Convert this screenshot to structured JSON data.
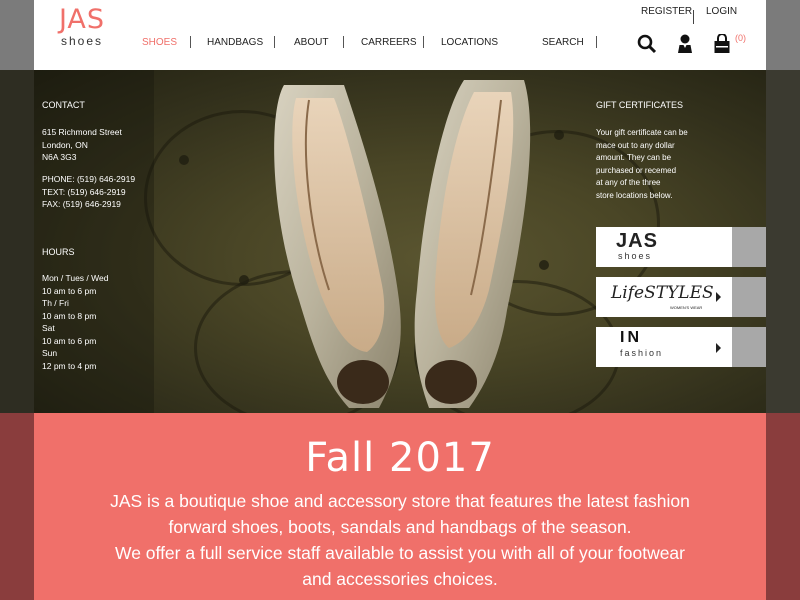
{
  "header": {
    "logo_top": "JAS",
    "logo_bottom": "shoes",
    "register": "REGISTER",
    "login": "LOGIN",
    "cart_count": "(0)"
  },
  "nav": {
    "items": [
      {
        "label": "SHOES",
        "active": true
      },
      {
        "label": "HANDBAGS",
        "active": false
      },
      {
        "label": "ABOUT",
        "active": false
      },
      {
        "label": "CARREERS",
        "active": false
      },
      {
        "label": "LOCATIONS",
        "active": false
      },
      {
        "label": "SEARCH",
        "active": false
      }
    ]
  },
  "contact": {
    "heading": "CONTACT",
    "address1": "615 Richmond Street",
    "address2": "London, ON",
    "address3": "N6A 3G3",
    "phone": "PHONE: (519) 646-2919",
    "text": "TEXT: (519) 646-2919",
    "fax": "FAX: (519) 646-2919"
  },
  "hours": {
    "heading": "HOURS",
    "lines": [
      "Mon / Tues / Wed",
      "10 am to 6 pm",
      "Th / Fri",
      "10 am to 8 pm",
      "Sat",
      "10 am to 6 pm",
      "Sun",
      "12 pm to 4 pm"
    ]
  },
  "gift": {
    "heading": "GIFT CERTIFICATES",
    "lines": [
      "Your gift certificate can be",
      "mace out to any dollar",
      "amount. They can be",
      "purchased or recemed",
      "at any of the three",
      "store locations below."
    ]
  },
  "brands": {
    "jas_top": "JAS",
    "jas_bottom": "shoes",
    "lifestyles": "LifeSTYLES",
    "lifestyles_sub": "WOMEN'S WEAR",
    "in_top": "IN",
    "in_bottom": "fashion"
  },
  "promo": {
    "title": "Fall 2017",
    "line1": "JAS is a boutique shoe and accessory store that features the latest fashion",
    "line2": "forward shoes, boots, sandals and handbags of the season.",
    "line3": "We offer a full service staff available to assist you with all of your footwear",
    "line4": "and accessories choices."
  },
  "colors": {
    "accent": "#f0706a",
    "header_bg": "#ffffff",
    "hero_bg": "#4a4626"
  }
}
